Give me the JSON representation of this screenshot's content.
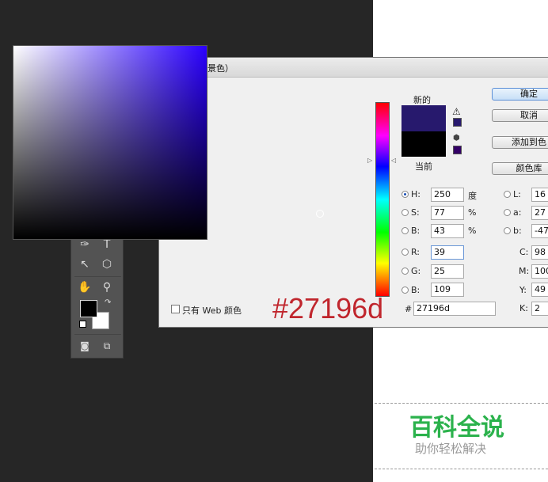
{
  "dialog": {
    "title": "拾色器（前景色）",
    "new_label": "新的",
    "current_label": "当前",
    "new_color": "#27196d",
    "current_color": "#000000",
    "web_only_label": "只有 Web 颜色",
    "hex_prefix": "#",
    "hex_value": "27196d",
    "buttons": {
      "ok": "确定",
      "cancel": "取消",
      "add_to_swatches": "添加到色",
      "color_libraries": "颜色库"
    },
    "hsb": {
      "h_label": "H:",
      "h_value": "250",
      "h_unit": "度",
      "s_label": "S:",
      "s_value": "77",
      "s_unit": "%",
      "b_label": "B:",
      "b_value": "43",
      "b_unit": "%"
    },
    "rgb": {
      "r_label": "R:",
      "r_value": "39",
      "g_label": "G:",
      "g_value": "25",
      "b_label": "B:",
      "b_value": "109"
    },
    "lab": {
      "l_label": "L:",
      "l_value": "16",
      "a_label": "a:",
      "a_value": "27",
      "b_label": "b:",
      "b_value": "-47"
    },
    "cmyk": {
      "c_label": "C:",
      "c_value": "98",
      "m_label": "M:",
      "m_value": "100",
      "y_label": "Y:",
      "y_value": "49",
      "k_label": "K:",
      "k_value": "2"
    }
  },
  "overlay": {
    "hex_big": "#27196d"
  },
  "watermark": {
    "title": "百科全说",
    "subtitle": "助你轻松解决"
  },
  "tools": [
    "marquee-icon",
    "move-icon",
    "lasso-icon",
    "quick-select-icon",
    "crop-icon",
    "eyedropper-icon",
    "healing-brush-icon",
    "brush-icon",
    "clone-stamp-icon",
    "history-brush-icon",
    "eraser-icon",
    "gradient-icon",
    "blur-icon",
    "dodge-icon",
    "pen-icon",
    "type-icon",
    "path-select-icon",
    "shape-icon",
    "hand-icon",
    "zoom-icon"
  ]
}
